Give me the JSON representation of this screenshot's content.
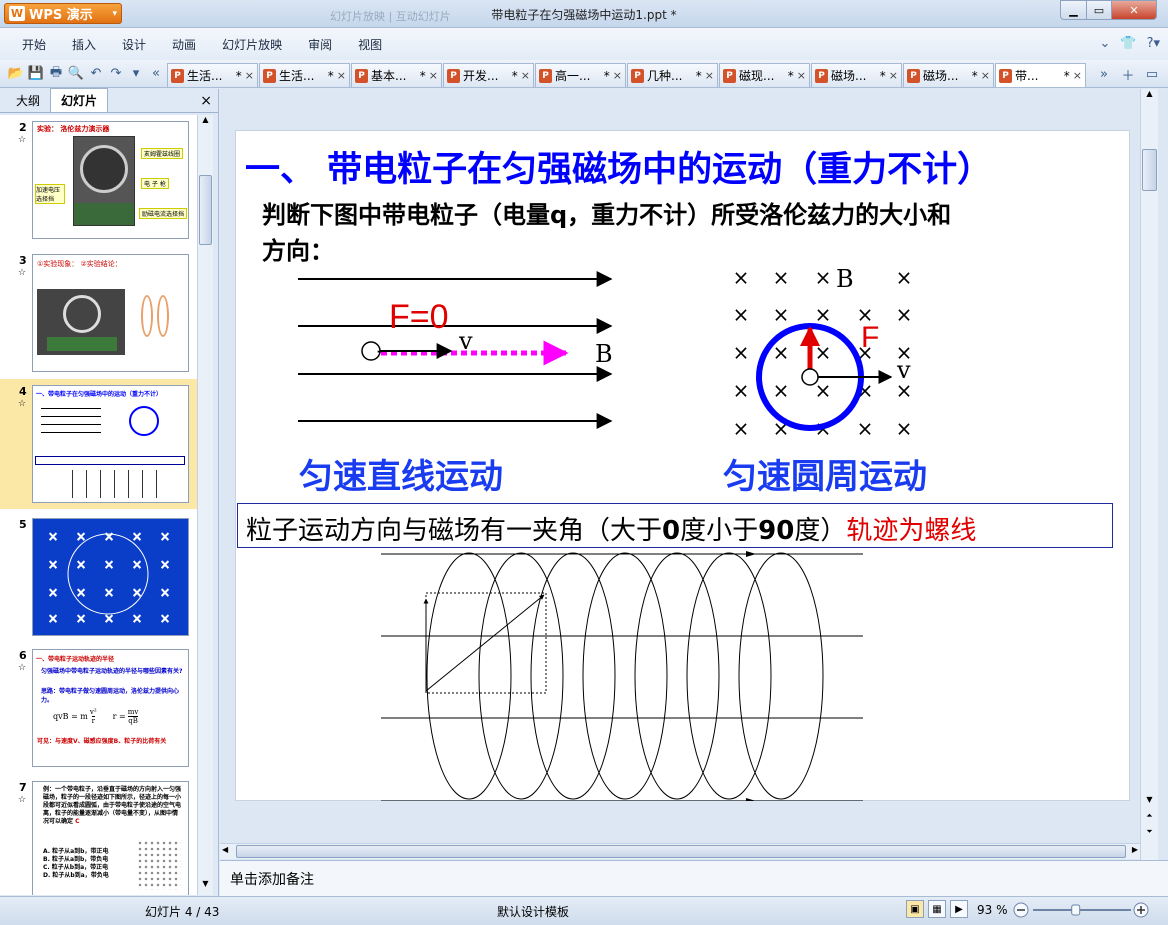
{
  "app": {
    "brand": "WPS 演示",
    "title": "带电粒子在匀强磁场中运动1.ppt *",
    "quick_access_ghost": "幻灯片放映  |  互动幻灯片"
  },
  "menu": [
    "开始",
    "插入",
    "设计",
    "动画",
    "幻灯片放映",
    "审阅",
    "视图"
  ],
  "doc_tabs": [
    {
      "label": "生活..."
    },
    {
      "label": "生活..."
    },
    {
      "label": "基本..."
    },
    {
      "label": "开发..."
    },
    {
      "label": "高一..."
    },
    {
      "label": "几种..."
    },
    {
      "label": "磁现..."
    },
    {
      "label": "磁场..."
    },
    {
      "label": "磁场..."
    },
    {
      "label": "带..."
    }
  ],
  "doc_tab_marks": {
    "modified": "*",
    "close": "×"
  },
  "left_panel": {
    "tab_outline": "大纲",
    "tab_slides": "幻灯片",
    "close": "×"
  },
  "thumbnails": [
    {
      "num": "2",
      "title": "实验：   洛伦兹力演示器",
      "labels": [
        "亥姆霍兹线圈",
        "电  子  枪",
        "加速电压选择挡",
        "励磁电流选择挡"
      ]
    },
    {
      "num": "3",
      "title": "①实验现象：  ②实验结论："
    },
    {
      "num": "4",
      "title": "一、带电粒子在匀强磁场中的运动（重力不计）"
    },
    {
      "num": "5"
    },
    {
      "num": "6",
      "lines": [
        "一、带电粒子运动轨迹的半径",
        "匀强磁场中带电粒子运动轨迹的半径与哪些因素有关?",
        "思路：带电粒子做匀速圆周运动，洛伦兹力提供向心力。",
        "可见：与速度V、磁感应强度B、粒子的比荷有关"
      ],
      "formula_left": "qvB = m",
      "formula_frac_num": "v²",
      "formula_frac_den": "r",
      "formula_right": "r =",
      "formula_r_num": "mv",
      "formula_r_den": "qB"
    },
    {
      "num": "7",
      "lines": [
        "例：一个带电粒子，沿垂直于磁场的方向射入一匀强磁场，粒子的一段径迹如下图所示，径迹上的每一小段都可近似看成圆弧，由于带电粒子使沿途的空气电离，粒子的能量逐渐减小（带电量不变），从图中情况可以确定"
      ],
      "mark": "C",
      "options": [
        "A. 粒子从a到b，带正电",
        "B. 粒子从a到b，带负电",
        "C. 粒子从b到a，带正电",
        "D. 粒子从b到a，带负电"
      ]
    }
  ],
  "slide": {
    "heading": "一、  带电粒子在匀强磁场中的运动（重力不计）",
    "question_line1": "判断下图中带电粒子（电量q，重力不计）所受洛伦兹力的大小和",
    "question_line2": "方向：",
    "fig1": {
      "force": "F=0",
      "velocity": "v",
      "field": "B",
      "charge": "-"
    },
    "fig2": {
      "field": "B",
      "force": "F",
      "velocity": "v",
      "cross": "×"
    },
    "label_linear": "匀速直线运动",
    "label_circular": "匀速圆周运动",
    "box_text_a": "粒子运动方向与磁场有一夹角（大于",
    "box_num_0": "0",
    "box_text_b": "度小于",
    "box_num_90": "90",
    "box_text_c": "度）",
    "box_text_red": "轨迹为螺线",
    "helix_turns": 7
  },
  "notes_placeholder": "单击添加备注",
  "status": {
    "slide_counter": "幻灯片 4 / 43",
    "template": "默认设计模板",
    "zoom": "93 %",
    "zoom_percent": 93
  },
  "colors": {
    "heading_blue": "#0000ff",
    "label_blue": "#1a3cf0",
    "accent_red": "#e00000",
    "magenta": "#ff00ff",
    "wps_orange": "#e27112",
    "slide5_bg": "#0a3dc8"
  }
}
